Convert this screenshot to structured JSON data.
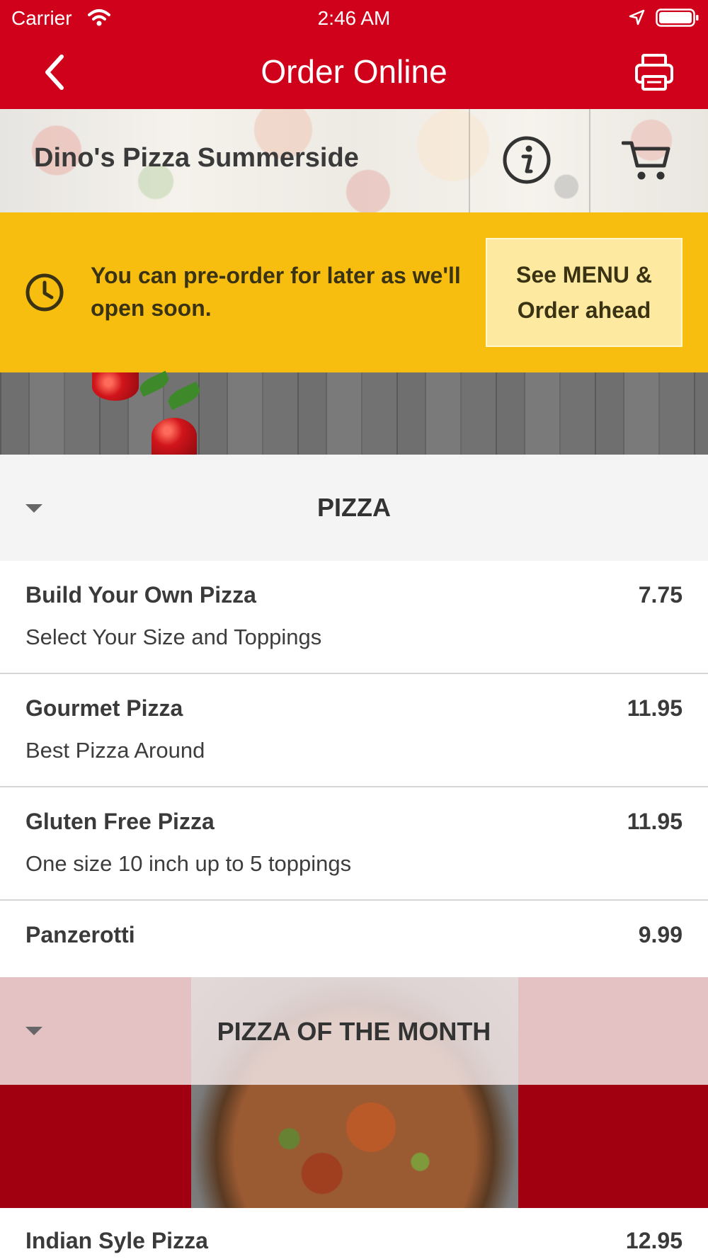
{
  "status": {
    "carrier": "Carrier",
    "time": "2:46 AM"
  },
  "nav": {
    "title": "Order Online"
  },
  "restaurant": {
    "name": "Dino's Pizza Summerside"
  },
  "notice": {
    "message": "You can pre-order for later as we'll open soon.",
    "cta_line1": "See MENU &",
    "cta_line2": "Order ahead"
  },
  "sections": [
    {
      "title": "PIZZA",
      "items": [
        {
          "name": "Build Your Own Pizza",
          "desc": "Select Your Size and Toppings",
          "price": "7.75"
        },
        {
          "name": "Gourmet Pizza",
          "desc": "Best Pizza Around",
          "price": "11.95"
        },
        {
          "name": "Gluten Free Pizza",
          "desc": "One size 10 inch up to 5 toppings",
          "price": "11.95"
        },
        {
          "name": "Panzerotti",
          "desc": "",
          "price": "9.99"
        }
      ]
    },
    {
      "title": "PIZZA OF THE MONTH",
      "items": [
        {
          "name": "Indian Syle Pizza",
          "desc": "",
          "price": "12.95"
        }
      ]
    }
  ],
  "colors": {
    "brand_red": "#d0021b",
    "notice_yellow": "#f7be10",
    "cta_bg": "#fde9a0"
  },
  "icons": {
    "back": "chevron-left-icon",
    "print": "printer-icon",
    "info": "info-icon",
    "cart": "cart-icon",
    "clock": "clock-icon"
  }
}
